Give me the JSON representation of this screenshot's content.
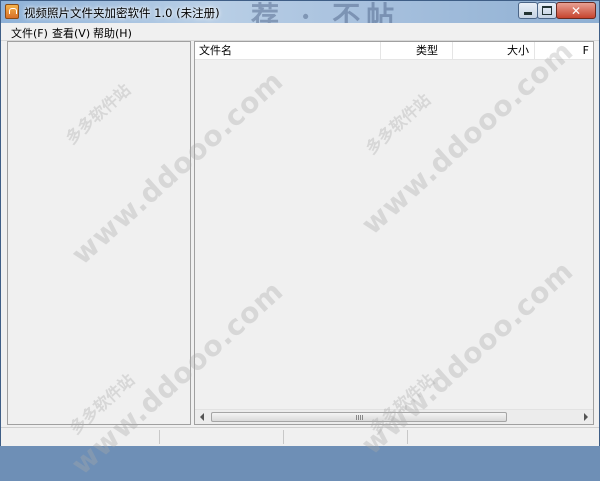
{
  "window": {
    "title": "视频照片文件夹加密软件 1.0 (未注册)",
    "title_decoration": "荐 · 不帖"
  },
  "menu": [
    {
      "label": "文件(F)"
    },
    {
      "label": "查看(V)"
    },
    {
      "label": "帮助(H)"
    }
  ],
  "file_list": {
    "columns": [
      {
        "label": "文件名"
      },
      {
        "label": "类型"
      },
      {
        "label": "大小"
      },
      {
        "label": "F"
      }
    ]
  },
  "watermark": {
    "site": "www.ddooo.com",
    "name": "多多软件站"
  }
}
